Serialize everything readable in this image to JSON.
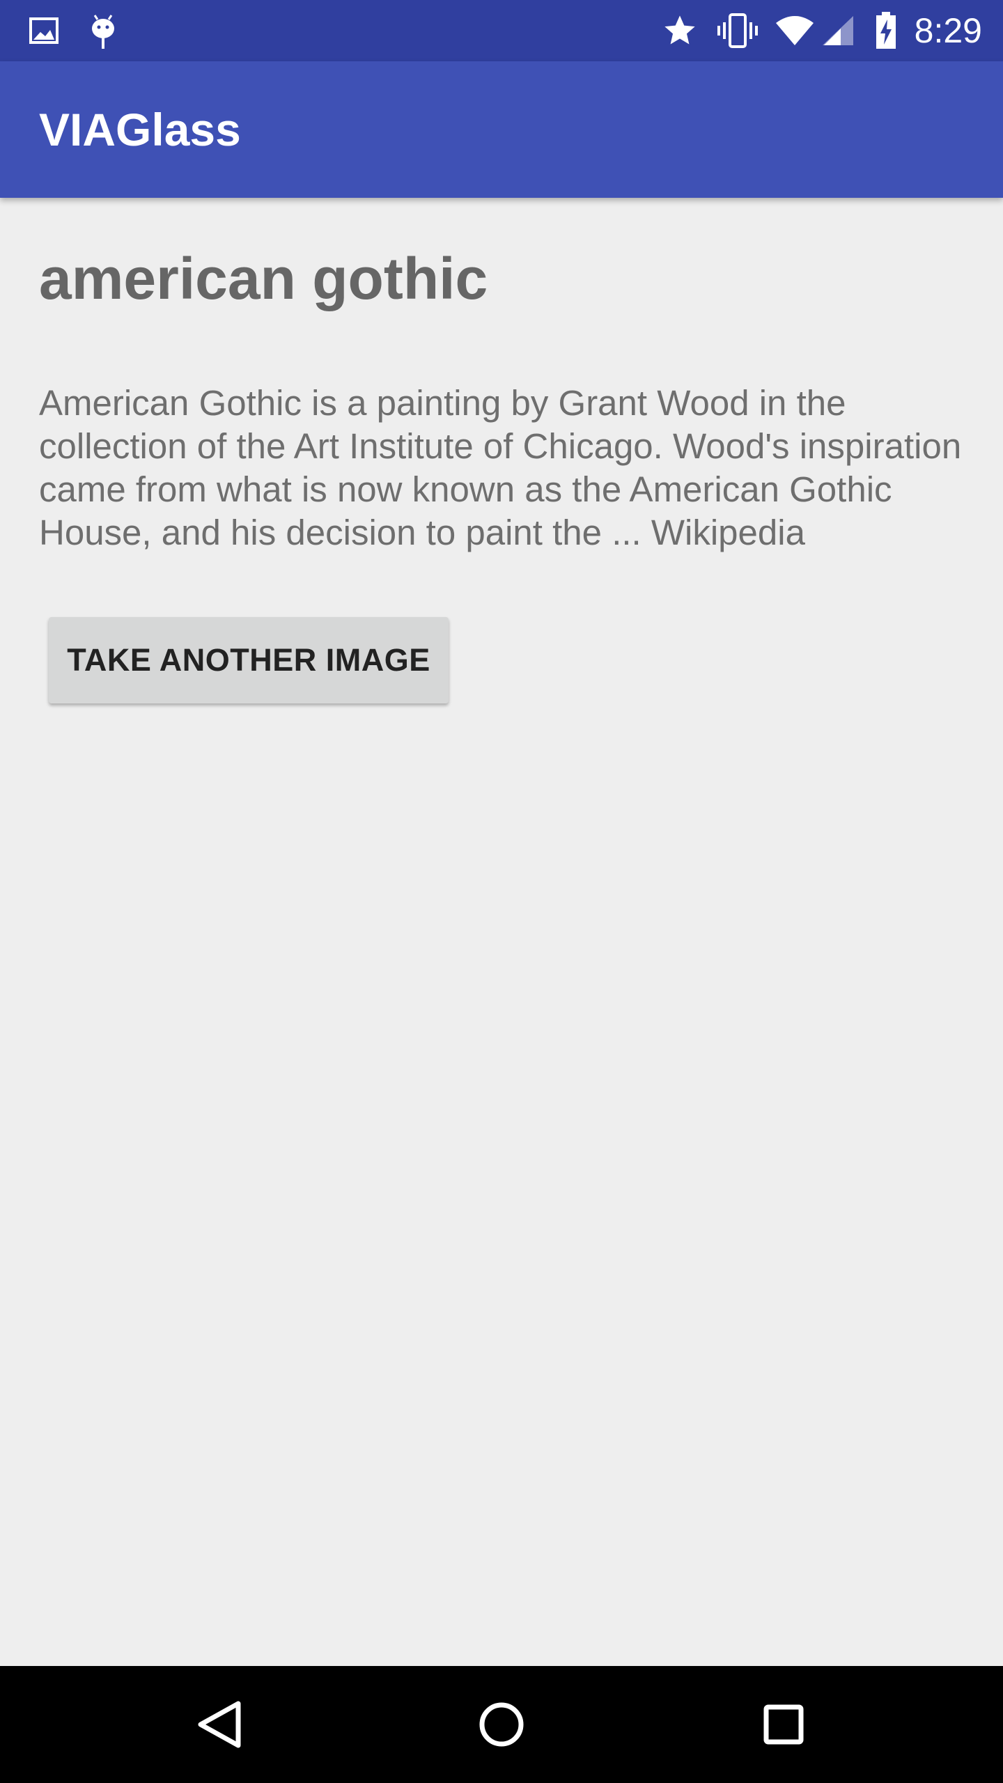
{
  "status_bar": {
    "time": "8:29",
    "icons": [
      "image-icon",
      "android-debug-icon",
      "star-icon",
      "vibrate-icon",
      "wifi-icon",
      "signal-icon",
      "battery-charging-icon"
    ]
  },
  "app_bar": {
    "title": "VIAGlass"
  },
  "main": {
    "title": "american gothic",
    "description": "American Gothic is a painting by Grant Wood in the collection of the Art Institute of Chicago. Wood's inspiration came from what is now known as the American Gothic House, and his decision to paint the ... Wikipedia",
    "button_label": "TAKE ANOTHER IMAGE"
  },
  "nav_bar": {
    "buttons": [
      "back-icon",
      "home-icon",
      "recents-icon"
    ]
  },
  "colors": {
    "status_bar": "#303f9f",
    "app_bar": "#3f51b5",
    "background": "#eeeeee",
    "button": "#d6d7d7"
  }
}
